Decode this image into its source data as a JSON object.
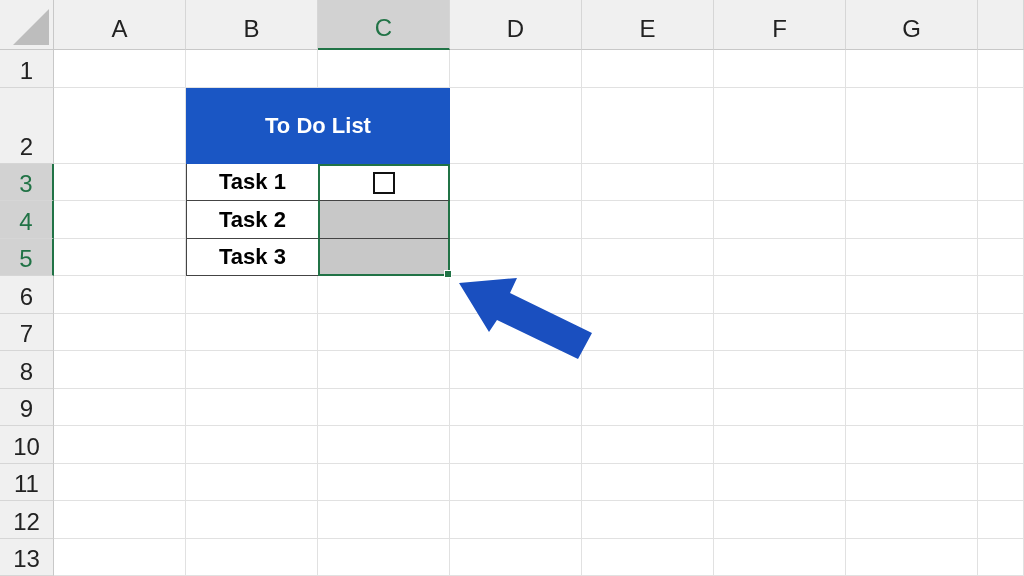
{
  "sheet": {
    "columns": [
      {
        "label": "A",
        "selected": false
      },
      {
        "label": "B",
        "selected": false
      },
      {
        "label": "C",
        "selected": true
      },
      {
        "label": "D",
        "selected": false
      },
      {
        "label": "E",
        "selected": false
      },
      {
        "label": "F",
        "selected": false
      },
      {
        "label": "G",
        "selected": false
      }
    ],
    "rows": [
      {
        "label": "1",
        "selected": false
      },
      {
        "label": "2",
        "selected": false
      },
      {
        "label": "3",
        "selected": true
      },
      {
        "label": "4",
        "selected": true
      },
      {
        "label": "5",
        "selected": true
      },
      {
        "label": "6",
        "selected": false
      },
      {
        "label": "7",
        "selected": false
      },
      {
        "label": "8",
        "selected": false
      },
      {
        "label": "9",
        "selected": false
      },
      {
        "label": "10",
        "selected": false
      },
      {
        "label": "11",
        "selected": false
      },
      {
        "label": "12",
        "selected": false
      },
      {
        "label": "13",
        "selected": false
      }
    ]
  },
  "todo_table": {
    "title": "To Do List",
    "tasks": [
      {
        "label": "Task 1",
        "cell": {
          "kind": "checkbox",
          "checked": false,
          "selected": true,
          "active": true
        }
      },
      {
        "label": "Task 2",
        "cell": {
          "kind": "empty",
          "selected": true,
          "active": false
        }
      },
      {
        "label": "Task 3",
        "cell": {
          "kind": "empty",
          "selected": true,
          "active": false
        }
      }
    ]
  }
}
